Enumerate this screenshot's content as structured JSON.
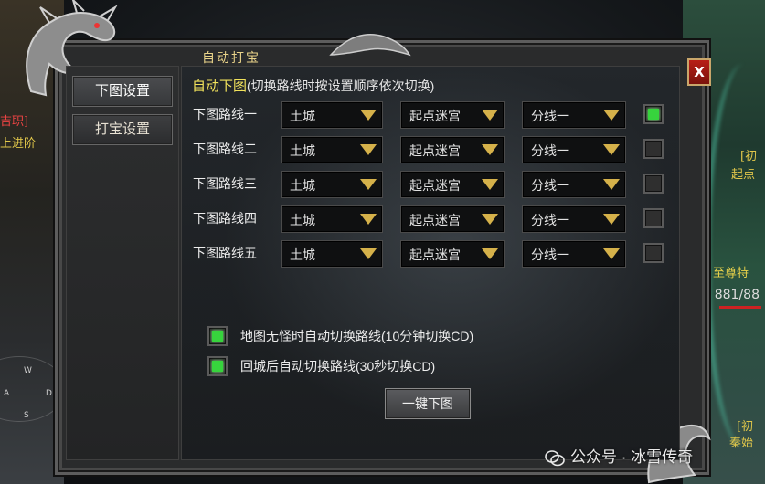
{
  "window": {
    "title": "自动打宝",
    "close_label": "X"
  },
  "sidebar": {
    "items": [
      {
        "label": "下图设置",
        "active": true
      },
      {
        "label": "打宝设置",
        "active": false
      }
    ]
  },
  "panel": {
    "title": "自动下图",
    "subtitle": "(切换路线时按设置顺序依次切换)",
    "routes": [
      {
        "label": "下图路线一",
        "map": "土城",
        "dest": "起点迷宫",
        "line": "分线一",
        "checked": true
      },
      {
        "label": "下图路线二",
        "map": "土城",
        "dest": "起点迷宫",
        "line": "分线一",
        "checked": false
      },
      {
        "label": "下图路线三",
        "map": "土城",
        "dest": "起点迷宫",
        "line": "分线一",
        "checked": false
      },
      {
        "label": "下图路线四",
        "map": "土城",
        "dest": "起点迷宫",
        "line": "分线一",
        "checked": false
      },
      {
        "label": "下图路线五",
        "map": "土城",
        "dest": "起点迷宫",
        "line": "分线一",
        "checked": false
      }
    ],
    "options": [
      {
        "label": "地图无怪时自动切换路线(10分钟切换CD)",
        "checked": true
      },
      {
        "label": "回城后自动切换路线(30秒切换CD)",
        "checked": true
      }
    ],
    "action_button": "一键下图"
  },
  "background": {
    "left_text_1": "吉职]",
    "left_text_2": "上进阶",
    "right_text_1": "[初",
    "right_text_2": "起点",
    "right_text_3": "至尊特",
    "score": "881/88",
    "right_text_4": "[初",
    "right_text_5": "秦始",
    "compass": {
      "w": "W",
      "a": "A",
      "d": "D",
      "s": "S"
    }
  },
  "watermark": "公众号 · 冰雪传奇",
  "colors": {
    "accent_yellow": "#f1e25c",
    "checkbox_green": "#37d43d",
    "arrow_gold": "#d5b14a",
    "close_red": "#b81f17"
  }
}
